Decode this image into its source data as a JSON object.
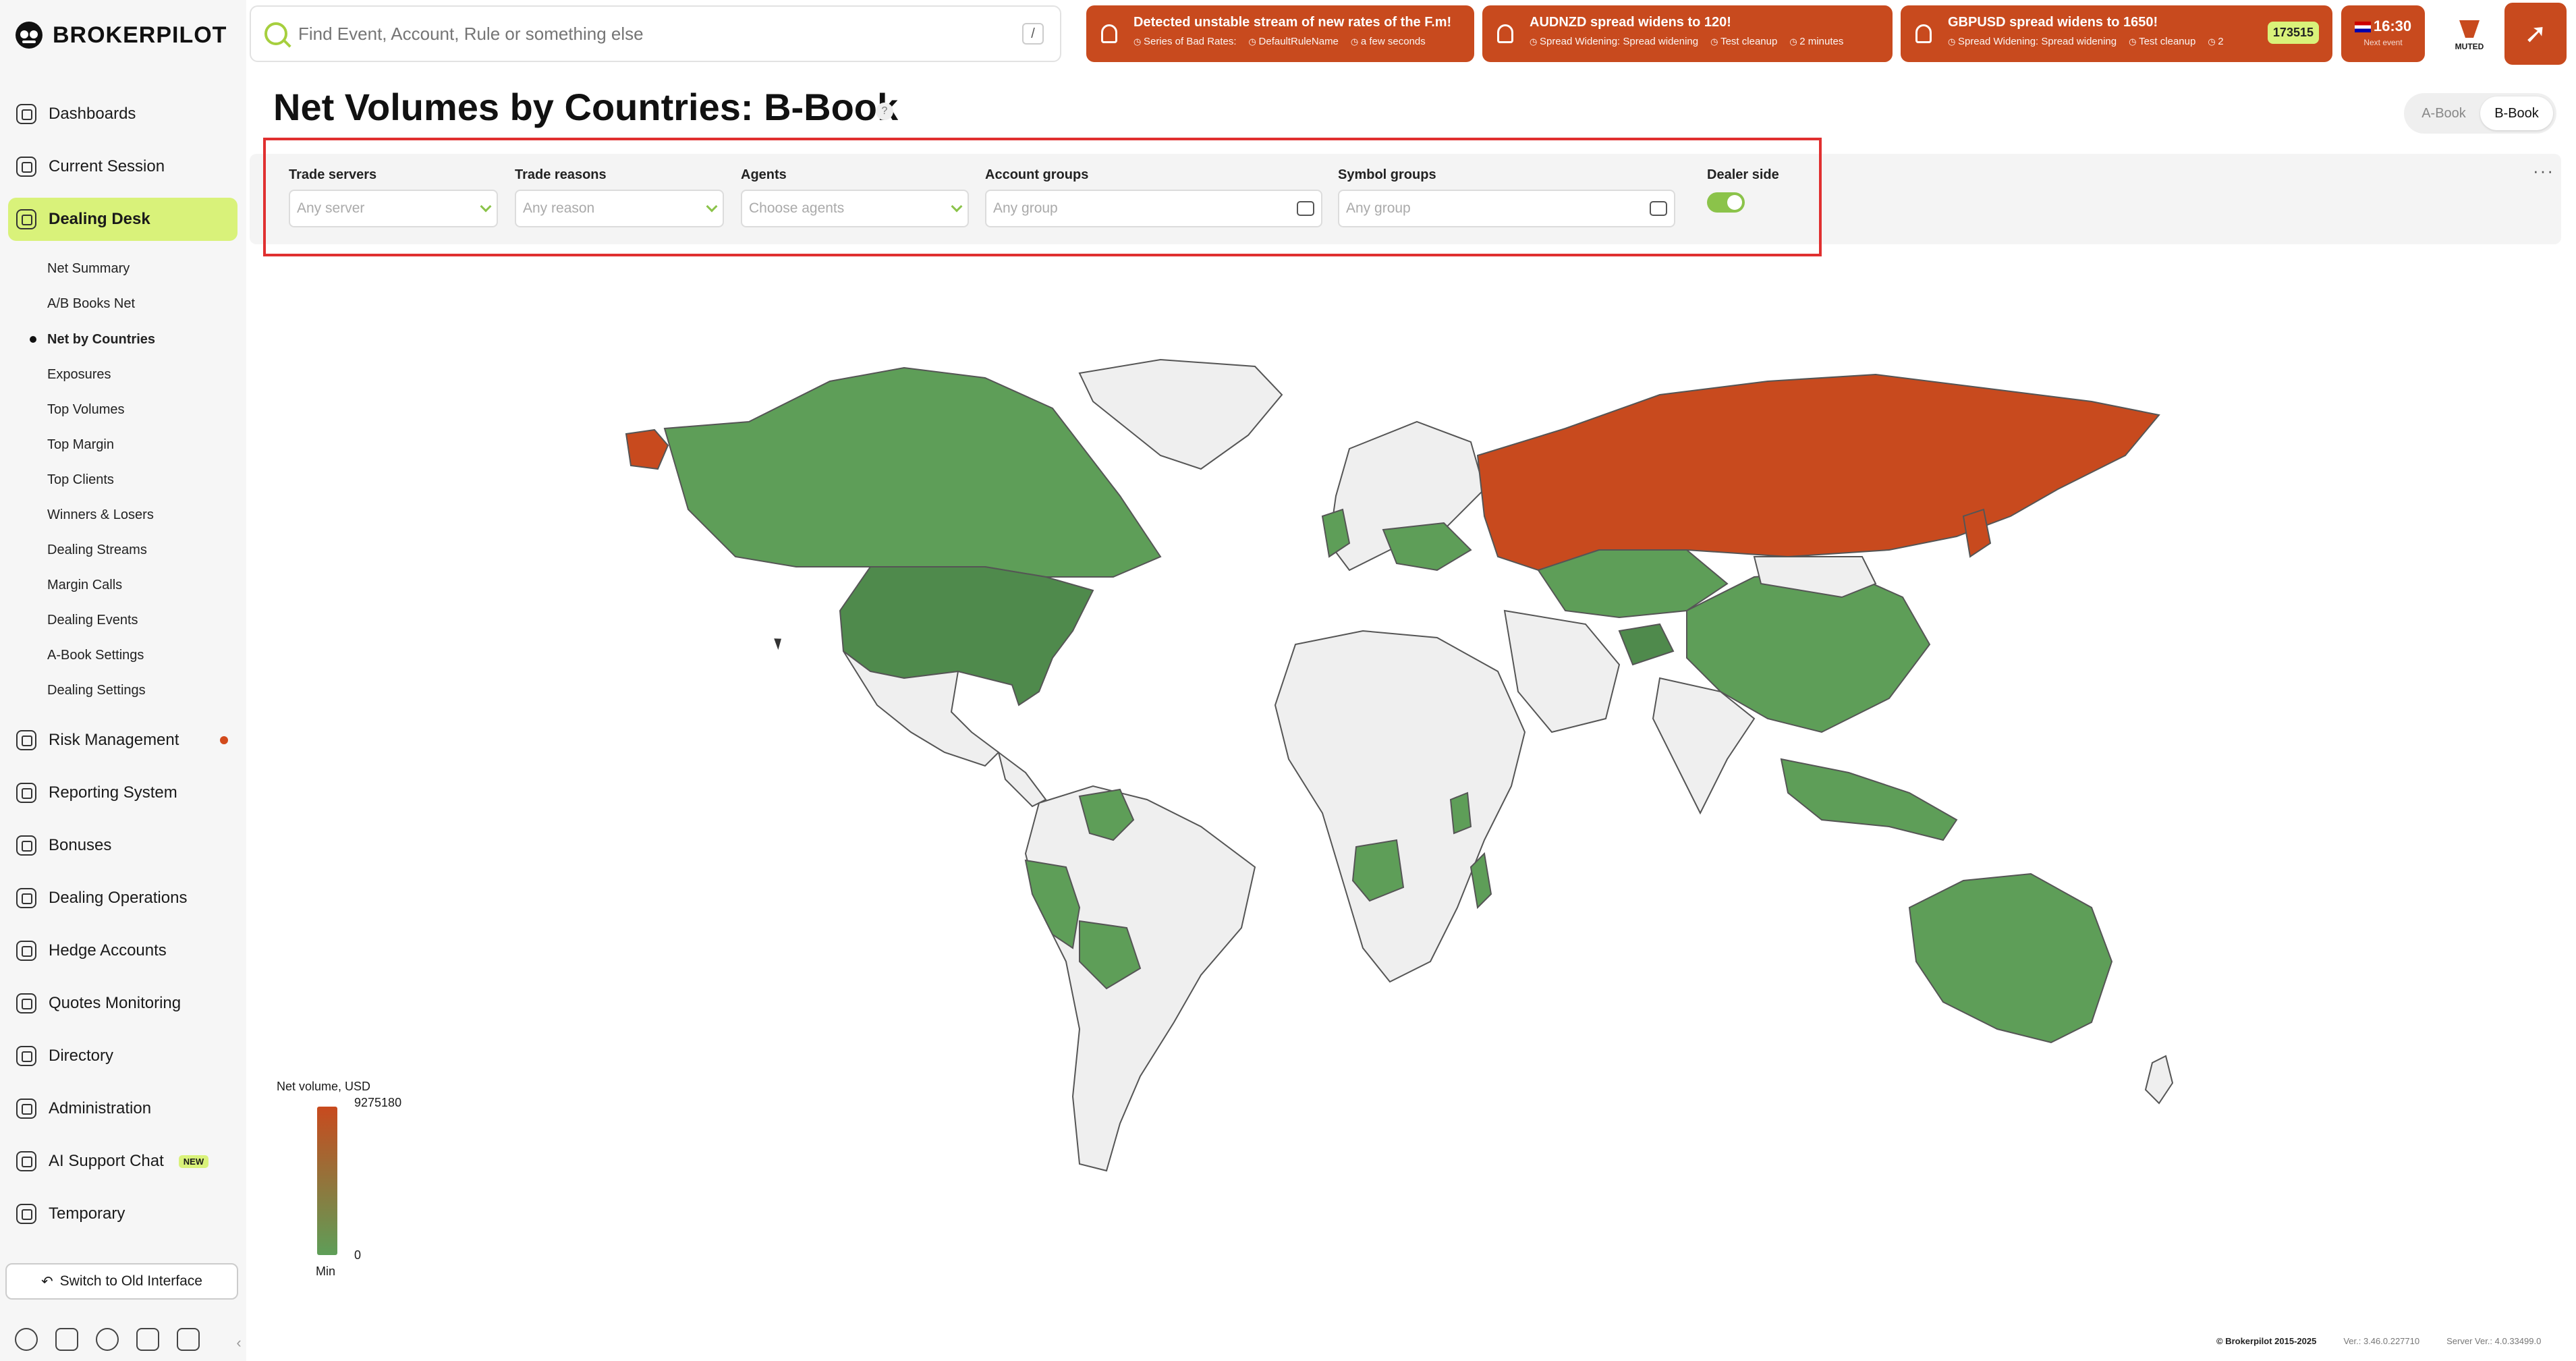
{
  "brand": "BROKERPILOT",
  "search": {
    "placeholder": "Find Event, Account, Rule or something else",
    "shortcut": "/"
  },
  "alerts": [
    {
      "title": "Detected unstable stream of new rates of the F.m!",
      "meta": [
        "Series of Bad Rates:",
        "DefaultRuleName",
        "a few seconds"
      ]
    },
    {
      "title": "AUDNZD spread widens to 120!",
      "meta": [
        "Spread Widening: Spread widening",
        "Test cleanup",
        "2 minutes"
      ]
    },
    {
      "title": "GBPUSD spread widens to 1650!",
      "meta": [
        "Spread Widening: Spread widening",
        "Test cleanup",
        "2"
      ],
      "count": "173515"
    }
  ],
  "clock": {
    "time": "16:30",
    "label": "Next event"
  },
  "muted_label": "MUTED",
  "nav": [
    {
      "label": "Dashboards"
    },
    {
      "label": "Current Session"
    },
    {
      "label": "Dealing Desk",
      "active": true
    },
    {
      "label": "Risk Management",
      "dot": true
    },
    {
      "label": "Reporting System"
    },
    {
      "label": "Bonuses"
    },
    {
      "label": "Dealing Operations"
    },
    {
      "label": "Hedge Accounts"
    },
    {
      "label": "Quotes Monitoring"
    },
    {
      "label": "Directory"
    },
    {
      "label": "Administration"
    },
    {
      "label": "AI Support Chat",
      "badge": "NEW"
    },
    {
      "label": "Temporary"
    }
  ],
  "subnav": [
    "Net Summary",
    "A/B Books Net",
    "Net by Countries",
    "Exposures",
    "Top Volumes",
    "Top Margin",
    "Top Clients",
    "Winners & Losers",
    "Dealing Streams",
    "Margin Calls",
    "Dealing Events",
    "A-Book Settings",
    "Dealing Settings"
  ],
  "switch_old": "Switch to Old Interface",
  "page": {
    "title": "Net Volumes by Countries: B-Book",
    "help": "?"
  },
  "book_toggle": {
    "a": "A-Book",
    "b": "B-Book",
    "selected": "B-Book"
  },
  "filters": {
    "trade_servers": {
      "label": "Trade servers",
      "placeholder": "Any server"
    },
    "trade_reasons": {
      "label": "Trade reasons",
      "placeholder": "Any reason"
    },
    "agents": {
      "label": "Agents",
      "placeholder": "Choose agents"
    },
    "account_groups": {
      "label": "Account groups",
      "placeholder": "Any group"
    },
    "symbol_groups": {
      "label": "Symbol groups",
      "placeholder": "Any group"
    },
    "dealer_side": {
      "label": "Dealer side",
      "on": true
    }
  },
  "legend": {
    "title": "Net volume, USD",
    "max": "9275180",
    "min": "0",
    "min_label": "Min"
  },
  "colors": {
    "high": "#c84a1e",
    "low": "#5e9e58",
    "none": "#efefef",
    "accent": "#d9f27a"
  },
  "footer": {
    "copyright": "© Brokerpilot 2015-2025",
    "ver": "Ver.: 3.46.0.227710",
    "server": "Server Ver.: 4.0.33499.0"
  }
}
